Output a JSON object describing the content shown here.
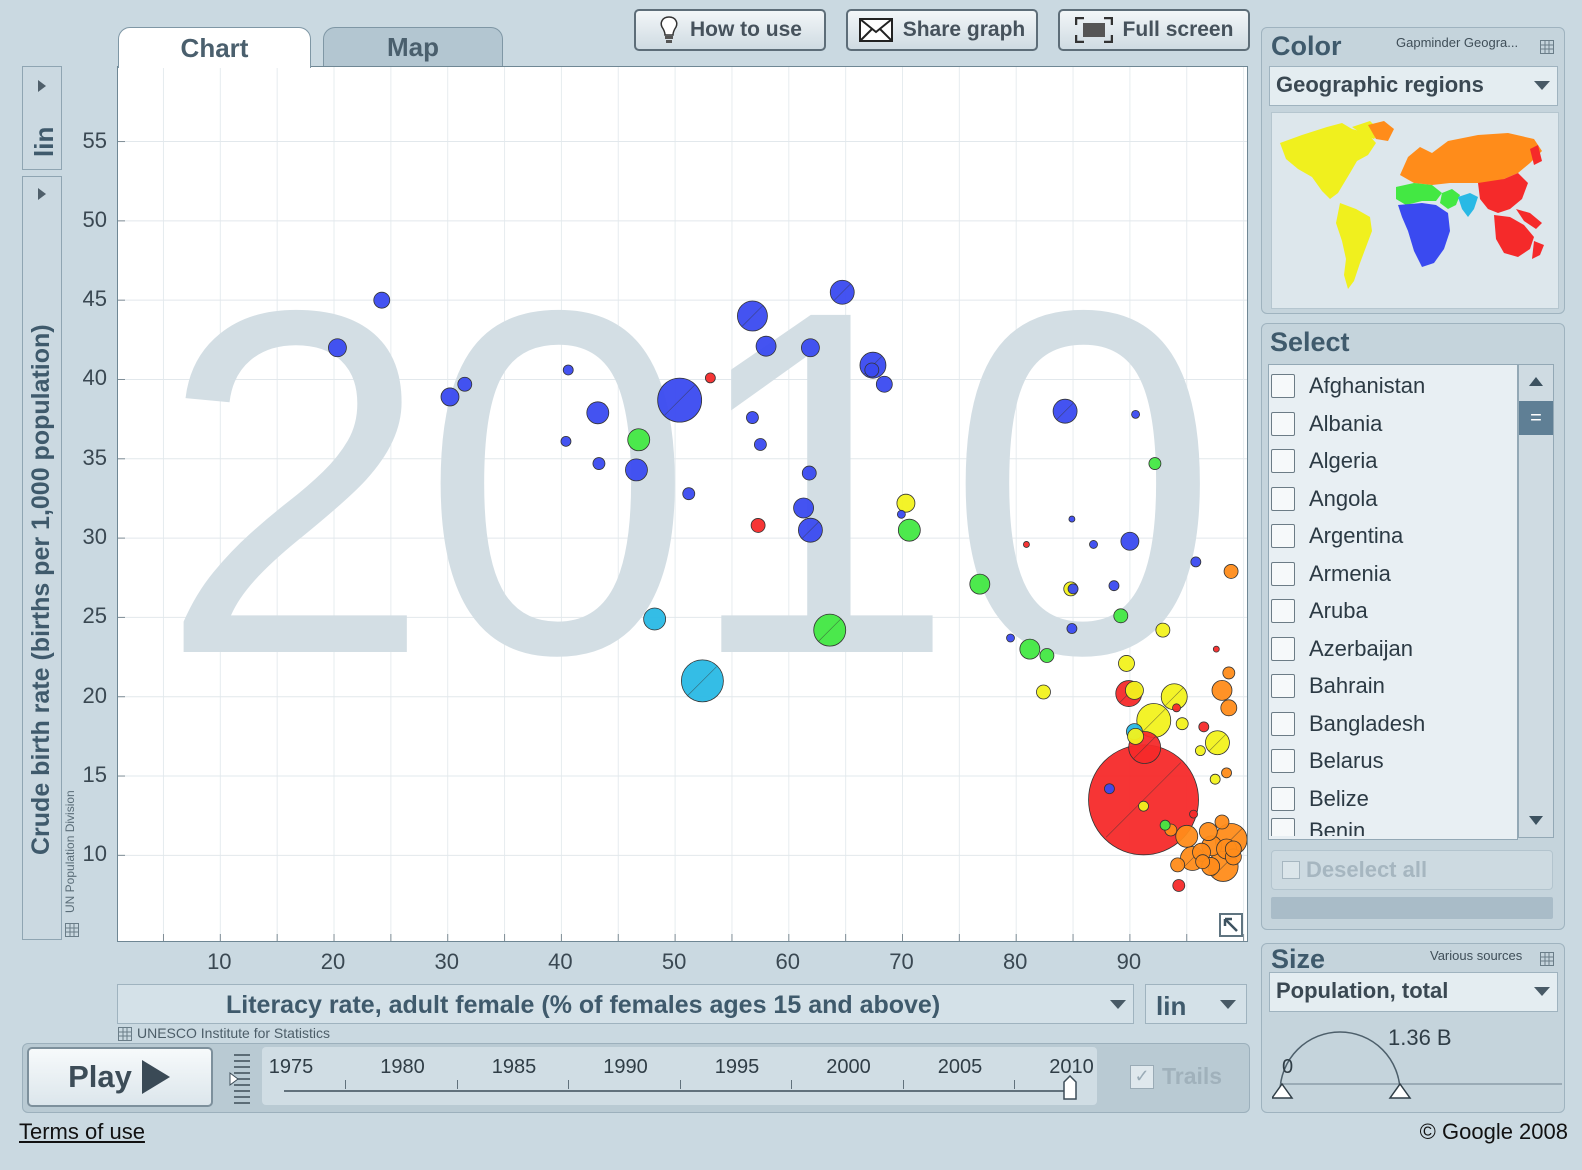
{
  "toolbar": {
    "how_to_use": "How to use",
    "share_graph": "Share graph",
    "full_screen": "Full screen"
  },
  "tabs": {
    "chart": "Chart",
    "map": "Map"
  },
  "y_axis": {
    "label": "Crude birth rate (births per 1,000 population)",
    "scale": "lin",
    "source": "UN Population Division"
  },
  "x_axis": {
    "label": "Literacy rate, adult female (% of females ages 15 and above)",
    "scale": "lin",
    "source": "UNESCO Institute for Statistics"
  },
  "year_watermark": "2010",
  "color_panel": {
    "title": "Color",
    "source": "Gapminder Geogra...",
    "selected": "Geographic regions"
  },
  "select_panel": {
    "title": "Select",
    "countries": [
      "Afghanistan",
      "Albania",
      "Algeria",
      "Angola",
      "Argentina",
      "Armenia",
      "Aruba",
      "Azerbaijan",
      "Bahrain",
      "Bangladesh",
      "Belarus",
      "Belize",
      "Benin"
    ],
    "deselect_all": "Deselect all"
  },
  "size_panel": {
    "title": "Size",
    "source": "Various sources",
    "selected": "Population, total",
    "max_label": "1.36 B",
    "min_label": "0"
  },
  "playback": {
    "play_label": "Play",
    "trails_label": "Trails",
    "years": [
      "1975",
      "1980",
      "1985",
      "1990",
      "1995",
      "2000",
      "2005",
      "2010"
    ],
    "current_year": 2010
  },
  "footer": {
    "terms": "Terms of use",
    "copyright": "© Google 2008"
  },
  "chart_data": {
    "type": "scatter",
    "xlabel": "Literacy rate, adult female (% of females ages 15 and above)",
    "ylabel": "Crude birth rate (births per 1,000 population)",
    "xlim": [
      1,
      100.3
    ],
    "ylim": [
      4.6,
      59.7
    ],
    "xticks": [
      10,
      20,
      30,
      40,
      50,
      60,
      70,
      80,
      90
    ],
    "yticks": [
      10,
      15,
      20,
      25,
      30,
      35,
      40,
      45,
      50,
      55
    ],
    "grid": true,
    "region_colors": {
      "sub_saharan_africa": "#3a4af0",
      "south_asia": "#29b9e5",
      "middle_east_north_africa": "#43e843",
      "america": "#f2f21e",
      "europe_central_asia": "#ff8c1a",
      "east_asia_pacific": "#f52a2a"
    },
    "points": [
      {
        "x": 24.2,
        "y": 45,
        "r": 8,
        "color": "#3a4af0"
      },
      {
        "x": 20.3,
        "y": 42,
        "r": 9,
        "color": "#3a4af0"
      },
      {
        "x": 30.2,
        "y": 38.9,
        "r": 9,
        "color": "#3a4af0"
      },
      {
        "x": 31.5,
        "y": 39.7,
        "r": 7,
        "color": "#3a4af0"
      },
      {
        "x": 40.6,
        "y": 40.6,
        "r": 5,
        "color": "#3a4af0"
      },
      {
        "x": 40.4,
        "y": 36.1,
        "r": 5,
        "color": "#3a4af0"
      },
      {
        "x": 43.2,
        "y": 37.9,
        "r": 11,
        "color": "#3a4af0"
      },
      {
        "x": 43.3,
        "y": 34.7,
        "r": 6,
        "color": "#3a4af0"
      },
      {
        "x": 46.6,
        "y": 34.3,
        "r": 11,
        "color": "#3a4af0"
      },
      {
        "x": 46.8,
        "y": 36.2,
        "r": 11,
        "color": "#43e843"
      },
      {
        "x": 50.4,
        "y": 38.7,
        "r": 22,
        "color": "#3a4af0"
      },
      {
        "x": 53.1,
        "y": 40.1,
        "r": 5,
        "color": "#f52a2a"
      },
      {
        "x": 51.2,
        "y": 32.8,
        "r": 6,
        "color": "#3a4af0"
      },
      {
        "x": 48.2,
        "y": 24.9,
        "r": 11,
        "color": "#29b9e5"
      },
      {
        "x": 52.4,
        "y": 21,
        "r": 21,
        "color": "#29b9e5"
      },
      {
        "x": 56.8,
        "y": 44,
        "r": 15,
        "color": "#3a4af0"
      },
      {
        "x": 58,
        "y": 42.1,
        "r": 10,
        "color": "#3a4af0"
      },
      {
        "x": 56.8,
        "y": 37.6,
        "r": 6,
        "color": "#3a4af0"
      },
      {
        "x": 57.5,
        "y": 35.9,
        "r": 6,
        "color": "#3a4af0"
      },
      {
        "x": 57.3,
        "y": 30.8,
        "r": 7,
        "color": "#f52a2a"
      },
      {
        "x": 61.9,
        "y": 42,
        "r": 9,
        "color": "#3a4af0"
      },
      {
        "x": 64.7,
        "y": 45.5,
        "r": 12,
        "color": "#3a4af0"
      },
      {
        "x": 61.8,
        "y": 34.1,
        "r": 7,
        "color": "#3a4af0"
      },
      {
        "x": 61.3,
        "y": 31.9,
        "r": 10,
        "color": "#3a4af0"
      },
      {
        "x": 61.9,
        "y": 30.5,
        "r": 12,
        "color": "#3a4af0"
      },
      {
        "x": 63.6,
        "y": 24.2,
        "r": 16,
        "color": "#43e843"
      },
      {
        "x": 67.4,
        "y": 40.9,
        "r": 13,
        "color": "#3a4af0"
      },
      {
        "x": 68.4,
        "y": 39.7,
        "r": 8,
        "color": "#3a4af0"
      },
      {
        "x": 67.3,
        "y": 40.6,
        "r": 7,
        "color": "#3a4af0"
      },
      {
        "x": 70.3,
        "y": 32.2,
        "r": 9,
        "color": "#f2f21e"
      },
      {
        "x": 69.9,
        "y": 31.5,
        "r": 4,
        "color": "#3a4af0"
      },
      {
        "x": 70.6,
        "y": 30.5,
        "r": 11,
        "color": "#43e843"
      },
      {
        "x": 76.8,
        "y": 27.1,
        "r": 10,
        "color": "#43e843"
      },
      {
        "x": 80.9,
        "y": 29.6,
        "r": 3,
        "color": "#f52a2a"
      },
      {
        "x": 79.5,
        "y": 23.7,
        "r": 4,
        "color": "#3a4af0"
      },
      {
        "x": 81.2,
        "y": 23,
        "r": 10,
        "color": "#43e843"
      },
      {
        "x": 82.7,
        "y": 22.6,
        "r": 7,
        "color": "#43e843"
      },
      {
        "x": 82.4,
        "y": 20.3,
        "r": 7,
        "color": "#f2f21e"
      },
      {
        "x": 84.3,
        "y": 38,
        "r": 12,
        "color": "#3a4af0"
      },
      {
        "x": 84.9,
        "y": 31.2,
        "r": 3,
        "color": "#3a4af0"
      },
      {
        "x": 84.8,
        "y": 26.8,
        "r": 7,
        "color": "#f2f21e"
      },
      {
        "x": 85,
        "y": 26.8,
        "r": 5,
        "color": "#3a4af0"
      },
      {
        "x": 84.9,
        "y": 24.3,
        "r": 5,
        "color": "#3a4af0"
      },
      {
        "x": 86.8,
        "y": 29.6,
        "r": 4,
        "color": "#3a4af0"
      },
      {
        "x": 88.6,
        "y": 27,
        "r": 5,
        "color": "#3a4af0"
      },
      {
        "x": 89.2,
        "y": 25.1,
        "r": 7,
        "color": "#43e843"
      },
      {
        "x": 90,
        "y": 29.8,
        "r": 9,
        "color": "#3a4af0"
      },
      {
        "x": 90.5,
        "y": 37.8,
        "r": 4,
        "color": "#3a4af0"
      },
      {
        "x": 92.2,
        "y": 34.7,
        "r": 6,
        "color": "#43e843"
      },
      {
        "x": 92.9,
        "y": 24.2,
        "r": 7,
        "color": "#f2f21e"
      },
      {
        "x": 95.8,
        "y": 28.5,
        "r": 5,
        "color": "#3a4af0"
      },
      {
        "x": 98.9,
        "y": 27.9,
        "r": 7,
        "color": "#ff8c1a"
      },
      {
        "x": 97.6,
        "y": 23,
        "r": 3,
        "color": "#f52a2a"
      },
      {
        "x": 89.7,
        "y": 22.1,
        "r": 8,
        "color": "#f2f21e"
      },
      {
        "x": 98.7,
        "y": 21.5,
        "r": 6,
        "color": "#ff8c1a"
      },
      {
        "x": 98.1,
        "y": 20.4,
        "r": 10,
        "color": "#ff8c1a"
      },
      {
        "x": 98.7,
        "y": 19.3,
        "r": 8,
        "color": "#ff8c1a"
      },
      {
        "x": 89.9,
        "y": 20.2,
        "r": 13,
        "color": "#f52a2a"
      },
      {
        "x": 90.4,
        "y": 20.4,
        "r": 9,
        "color": "#f2f21e"
      },
      {
        "x": 93.9,
        "y": 20,
        "r": 13,
        "color": "#f2f21e"
      },
      {
        "x": 94.1,
        "y": 19.3,
        "r": 4,
        "color": "#f52a2a"
      },
      {
        "x": 92.1,
        "y": 18.5,
        "r": 17,
        "color": "#f2f21e"
      },
      {
        "x": 94.6,
        "y": 18.3,
        "r": 6,
        "color": "#f2f21e"
      },
      {
        "x": 96.5,
        "y": 18.1,
        "r": 5,
        "color": "#f52a2a"
      },
      {
        "x": 90.4,
        "y": 17.8,
        "r": 8,
        "color": "#29b9e5"
      },
      {
        "x": 90.5,
        "y": 17.5,
        "r": 8,
        "color": "#f2f21e"
      },
      {
        "x": 91.3,
        "y": 16.8,
        "r": 16,
        "color": "#f52a2a"
      },
      {
        "x": 97.7,
        "y": 17.1,
        "r": 12,
        "color": "#f2f21e"
      },
      {
        "x": 96.2,
        "y": 16.6,
        "r": 5,
        "color": "#f2f21e"
      },
      {
        "x": 98.5,
        "y": 15.2,
        "r": 5,
        "color": "#ff8c1a"
      },
      {
        "x": 97.5,
        "y": 14.8,
        "r": 5,
        "color": "#f2f21e"
      },
      {
        "x": 88.2,
        "y": 14.2,
        "r": 5,
        "color": "#3a4af0"
      },
      {
        "x": 91.2,
        "y": 13.5,
        "r": 55,
        "color": "#f52a2a"
      },
      {
        "x": 91.2,
        "y": 13.1,
        "r": 5,
        "color": "#f2f21e"
      },
      {
        "x": 95.6,
        "y": 12.6,
        "r": 4,
        "color": "#f52a2a"
      },
      {
        "x": 93.1,
        "y": 11.9,
        "r": 5,
        "color": "#43e843"
      },
      {
        "x": 93.6,
        "y": 11.6,
        "r": 6,
        "color": "#ff8c1a"
      },
      {
        "x": 95,
        "y": 11.2,
        "r": 11,
        "color": "#ff8c1a"
      },
      {
        "x": 96.9,
        "y": 11.5,
        "r": 9,
        "color": "#ff8c1a"
      },
      {
        "x": 98.1,
        "y": 12.1,
        "r": 7,
        "color": "#ff8c1a"
      },
      {
        "x": 98.9,
        "y": 11,
        "r": 16,
        "color": "#ff8c1a"
      },
      {
        "x": 97.2,
        "y": 10.6,
        "r": 10,
        "color": "#ff8c1a"
      },
      {
        "x": 98.5,
        "y": 10.4,
        "r": 10,
        "color": "#ff8c1a"
      },
      {
        "x": 96.3,
        "y": 10.2,
        "r": 9,
        "color": "#ff8c1a"
      },
      {
        "x": 95.5,
        "y": 9.8,
        "r": 12,
        "color": "#ff8c1a"
      },
      {
        "x": 97.1,
        "y": 9.3,
        "r": 9,
        "color": "#ff8c1a"
      },
      {
        "x": 98.2,
        "y": 9.3,
        "r": 15,
        "color": "#ff8c1a"
      },
      {
        "x": 99.1,
        "y": 9.9,
        "r": 8,
        "color": "#ff8c1a"
      },
      {
        "x": 99.1,
        "y": 10.4,
        "r": 8,
        "color": "#ff8c1a"
      },
      {
        "x": 96.4,
        "y": 9.6,
        "r": 7,
        "color": "#ff8c1a"
      },
      {
        "x": 94.2,
        "y": 9.4,
        "r": 7,
        "color": "#ff8c1a"
      },
      {
        "x": 94.3,
        "y": 8.1,
        "r": 6,
        "color": "#f52a2a"
      }
    ]
  }
}
